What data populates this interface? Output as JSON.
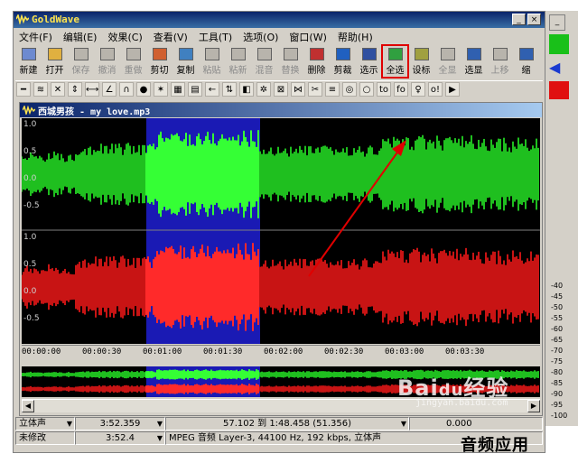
{
  "window": {
    "title": "GoldWave",
    "min_label": "_",
    "close_label": "×"
  },
  "menu": [
    "文件(F)",
    "编辑(E)",
    "效果(C)",
    "查看(V)",
    "工具(T)",
    "选项(O)",
    "窗口(W)",
    "帮助(H)"
  ],
  "toolbar": [
    {
      "label": "新建",
      "state": "on"
    },
    {
      "label": "打开",
      "state": "on"
    },
    {
      "label": "保存",
      "state": "off"
    },
    {
      "label": "撤消",
      "state": "off"
    },
    {
      "label": "重做",
      "state": "off"
    },
    {
      "label": "剪切",
      "state": "on"
    },
    {
      "label": "复制",
      "state": "on"
    },
    {
      "label": "粘贴",
      "state": "off"
    },
    {
      "label": "粘新",
      "state": "off"
    },
    {
      "label": "混音",
      "state": "off"
    },
    {
      "label": "替换",
      "state": "off"
    },
    {
      "label": "删除",
      "state": "on"
    },
    {
      "label": "剪裁",
      "state": "on"
    },
    {
      "label": "选示",
      "state": "on"
    },
    {
      "label": "全选",
      "state": "selected"
    },
    {
      "label": "设标",
      "state": "on"
    },
    {
      "label": "全显",
      "state": "off"
    },
    {
      "label": "选显",
      "state": "on"
    },
    {
      "label": "上移",
      "state": "off"
    },
    {
      "label": "缩",
      "state": "on"
    }
  ],
  "effects_toolbar": [
    "━",
    "≋",
    "✕",
    "⇕",
    "⟷",
    "∠",
    "∩",
    "●",
    "✶",
    "▦",
    "▤",
    "←",
    "⇅",
    "◧",
    "✲",
    "⊠",
    "⋈",
    "✂",
    "≡",
    "◎",
    "○",
    "to",
    "fo",
    "♀",
    "o!",
    "▶"
  ],
  "document": {
    "title": "西城男孩 - my love.mp3",
    "y_labels_top": [
      "1.0",
      "0.5",
      "0.0",
      "-0.5"
    ],
    "y_labels_bottom": [
      "1.0",
      "0.5",
      "0.0",
      "-0.5"
    ],
    "time_ticks": [
      "00:00:00",
      "00:00:30",
      "00:01:00",
      "00:01:30",
      "00:02:00",
      "00:02:30",
      "00:03:00",
      "00:03:30"
    ]
  },
  "status": {
    "channel": "立体声",
    "duration": "3:52.359",
    "selection": "57.102 到 1:48.458 (51.356)",
    "position": "0.000",
    "modified": "未修改",
    "length2": "3:52.4",
    "format": "MPEG 音频 Layer-3, 44100 Hz, 192 kbps, 立体声"
  },
  "right_strip_labels": [
    "-40",
    "-45",
    "-50",
    "-55",
    "-60",
    "-65",
    "-70",
    "-75",
    "-80",
    "-85",
    "-90",
    "-95",
    "-100"
  ],
  "watermark": {
    "brand": "Bai",
    "paw": "du",
    "suffix": "经验",
    "url": "jingyan.baidu.com"
  },
  "caption": "音频应用",
  "colors": {
    "left_channel": "#1fbf1f",
    "right_channel": "#c81414",
    "selected_left": "#35ff35",
    "selected_right": "#ff2a2a",
    "selection_bg": "#1a1ab4",
    "annotation_red": "#e00000"
  }
}
